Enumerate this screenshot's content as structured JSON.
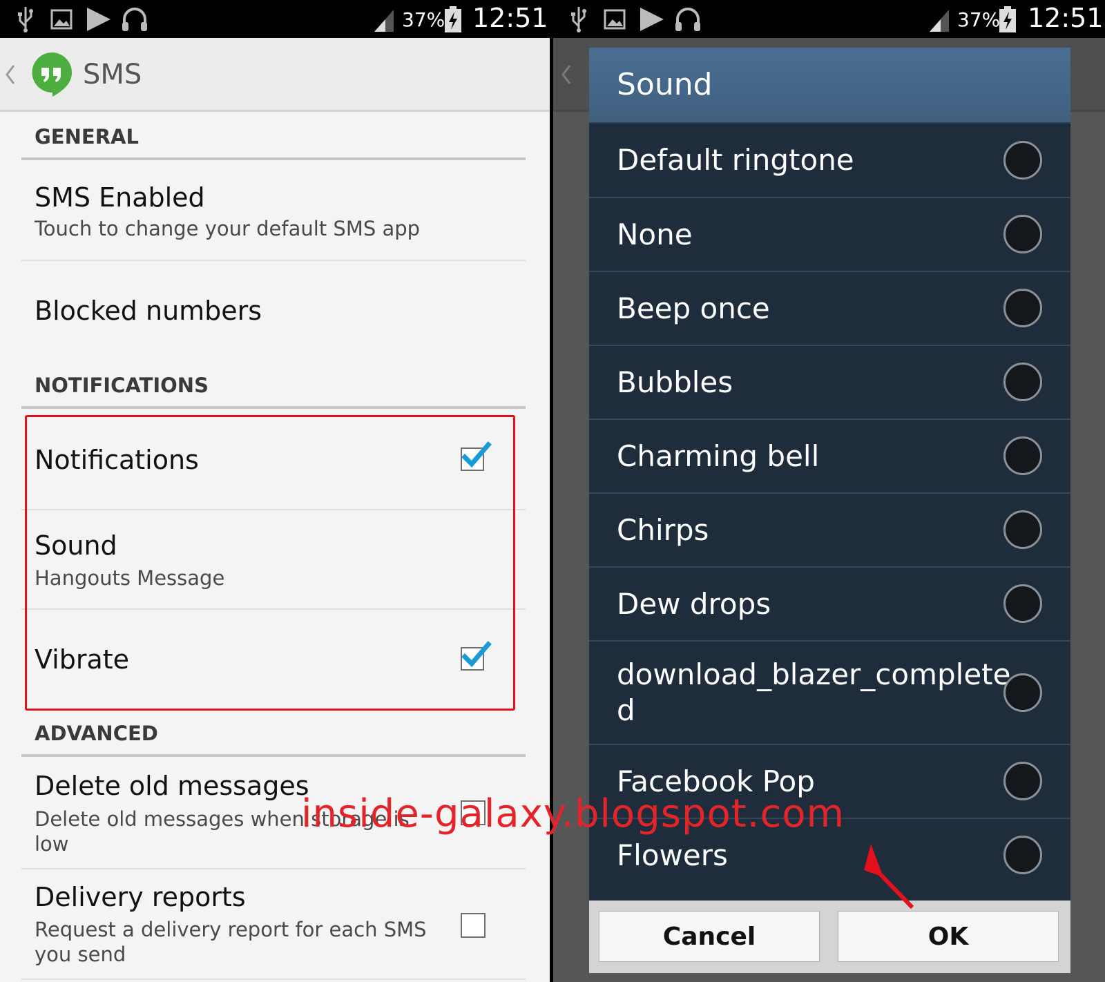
{
  "status": {
    "battery": "37%",
    "time": "12:51"
  },
  "left": {
    "app_title": "SMS",
    "sections": {
      "general": "GENERAL",
      "notifications": "NOTIFICATIONS",
      "advanced": "ADVANCED"
    },
    "sms_enabled": {
      "title": "SMS Enabled",
      "subtitle": "Touch to change your default SMS app"
    },
    "blocked": {
      "title": "Blocked numbers"
    },
    "notifications": {
      "title": "Notifications",
      "checked": true
    },
    "sound": {
      "title": "Sound",
      "subtitle": "Hangouts Message"
    },
    "vibrate": {
      "title": "Vibrate",
      "checked": true
    },
    "delete_old": {
      "title": "Delete old messages",
      "subtitle_1": "Delete old messages when storage is",
      "subtitle_2": "low",
      "checked": false
    },
    "delivery": {
      "title": "Delivery reports",
      "subtitle_1": "Request a delivery report for each SMS",
      "subtitle_2": "you send",
      "checked": false
    }
  },
  "dialog": {
    "title": "Sound",
    "options": [
      {
        "label": "Default ringtone"
      },
      {
        "label": "None"
      },
      {
        "label": "Beep once"
      },
      {
        "label": "Bubbles"
      },
      {
        "label": "Charming bell"
      },
      {
        "label": "Chirps"
      },
      {
        "label": "Dew drops"
      },
      {
        "label_1": "download_blazer_complete",
        "label_2": "d"
      },
      {
        "label": "Facebook Pop"
      },
      {
        "label": "Flowers"
      }
    ],
    "cancel": "Cancel",
    "ok": "OK"
  },
  "watermark": "inside-galaxy.blogspot.com",
  "colors": {
    "highlight": "#e3111b",
    "check": "#1a9ad6",
    "dialog_bg": "#1e2c3c",
    "dialog_header": "#45678a"
  }
}
